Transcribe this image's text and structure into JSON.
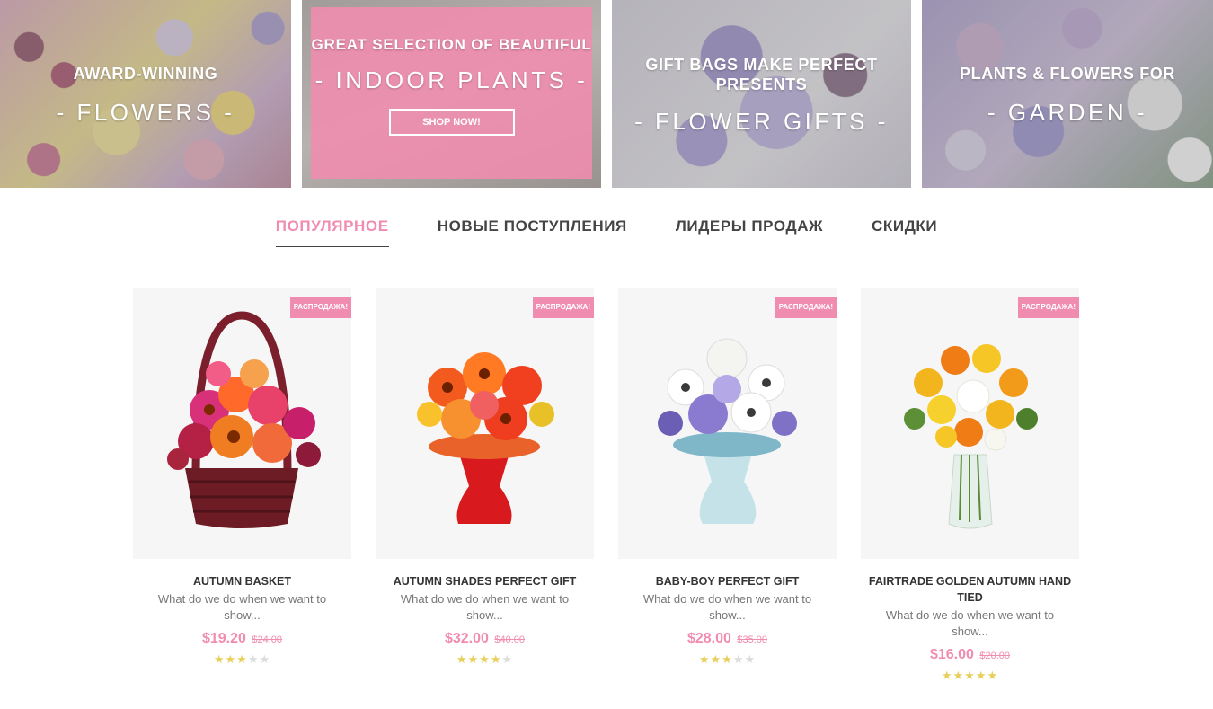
{
  "banners": [
    {
      "small": "AWARD-WINNING",
      "big": "- FLOWERS -"
    },
    {
      "small": "GREAT SELECTION OF BEAUTIFUL",
      "big": "- INDOOR PLANTS -",
      "button": "SHOP NOW!"
    },
    {
      "small": "GIFT BAGS MAKE PERFECT PRESENTS",
      "big": "- FLOWER GIFTS -"
    },
    {
      "small": "PLANTS & FLOWERS FOR",
      "big": "- GARDEN -"
    }
  ],
  "tabs": [
    {
      "label": "ПОПУЛЯРНОЕ",
      "active": true
    },
    {
      "label": "НОВЫЕ ПОСТУПЛЕНИЯ"
    },
    {
      "label": "ЛИДЕРЫ ПРОДАЖ"
    },
    {
      "label": "СКИДКИ"
    }
  ],
  "products": [
    {
      "badge": "РАСПРОДАЖА!",
      "name": "AUTUMN BASKET",
      "desc": "What do we do when we want to show...",
      "price": "$19.20",
      "old_price": "$24.00",
      "rating": 3,
      "rating_max": 5
    },
    {
      "badge": "РАСПРОДАЖА!",
      "name": "AUTUMN SHADES PERFECT GIFT",
      "desc": "What do we do when we want to show...",
      "price": "$32.00",
      "old_price": "$40.00",
      "rating": 4,
      "rating_max": 5
    },
    {
      "badge": "РАСПРОДАЖА!",
      "name": "BABY-BOY PERFECT GIFT",
      "desc": "What do we do when we want to show...",
      "price": "$28.00",
      "old_price": "$35.00",
      "rating": 3,
      "rating_max": 5
    },
    {
      "badge": "РАСПРОДАЖА!",
      "name": "FAIRTRADE GOLDEN AUTUMN HAND TIED",
      "desc": "What do we do when we want to show...",
      "price": "$16.00",
      "old_price": "$20.00",
      "rating": 5,
      "rating_max": 5
    }
  ],
  "colors": {
    "accent": "#f18cb1",
    "star": "#e8cf5c",
    "text": "#444444"
  }
}
